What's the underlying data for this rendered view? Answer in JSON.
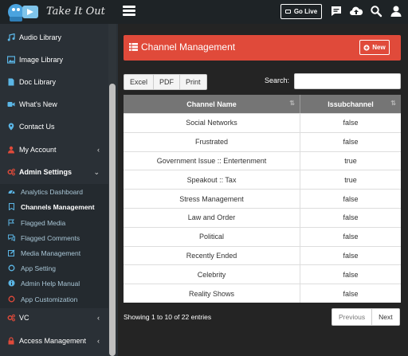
{
  "app": {
    "logo_text": "Take It Out"
  },
  "topbar": {
    "go_live_label": "Go Live"
  },
  "sidebar": {
    "items": [
      {
        "label": "Audio Library",
        "icon": "music-icon"
      },
      {
        "label": "Image Library",
        "icon": "image-icon"
      },
      {
        "label": "Doc Library",
        "icon": "document-icon"
      },
      {
        "label": "What's New",
        "icon": "video-camera-icon"
      },
      {
        "label": "Contact Us",
        "icon": "map-marker-icon"
      },
      {
        "label": "My Account",
        "icon": "user-icon"
      },
      {
        "label": "Admin Settings",
        "icon": "cogs-icon"
      }
    ],
    "admin_sub": [
      {
        "label": "Analytics Dashboard",
        "icon": "dashboard-icon"
      },
      {
        "label": "Channels Management",
        "icon": "bookmark-icon"
      },
      {
        "label": "Flagged Media",
        "icon": "flag-icon"
      },
      {
        "label": "Flagged Comments",
        "icon": "comments-icon"
      },
      {
        "label": "Media Management",
        "icon": "pencil-square-icon"
      },
      {
        "label": "App Setting",
        "icon": "circle-icon"
      },
      {
        "label": "Admin Help Manual",
        "icon": "info-icon"
      },
      {
        "label": "App Customization",
        "icon": "circle-icon"
      }
    ],
    "bottom": [
      {
        "label": "VC",
        "icon": "cogs-icon"
      },
      {
        "label": "Access Management",
        "icon": "lock-icon"
      }
    ]
  },
  "main": {
    "title": "Channel Management",
    "new_label": "New",
    "export_buttons": [
      "Excel",
      "PDF",
      "Print"
    ],
    "search_label": "Search:",
    "search_value": "",
    "columns": [
      "Channel Name",
      "Issubchannel"
    ],
    "rows": [
      [
        "Social Networks",
        "false"
      ],
      [
        "Frustrated",
        "false"
      ],
      [
        "Government Issue :: Entertenment",
        "true"
      ],
      [
        "Speakout :: Tax",
        "true"
      ],
      [
        "Stress Management",
        "false"
      ],
      [
        "Law and Order",
        "false"
      ],
      [
        "Political",
        "false"
      ],
      [
        "Recently Ended",
        "false"
      ],
      [
        "Celebrity",
        "false"
      ],
      [
        "Reality Shows",
        "false"
      ]
    ],
    "info": "Showing 1 to 10 of 22 entries",
    "pager": {
      "previous": "Previous",
      "next": "Next"
    }
  },
  "colors": {
    "header_panel": "#e04a3a",
    "sidebar_icon": "#5bb6e6",
    "sidebar_icon_red": "#e04a3a"
  }
}
